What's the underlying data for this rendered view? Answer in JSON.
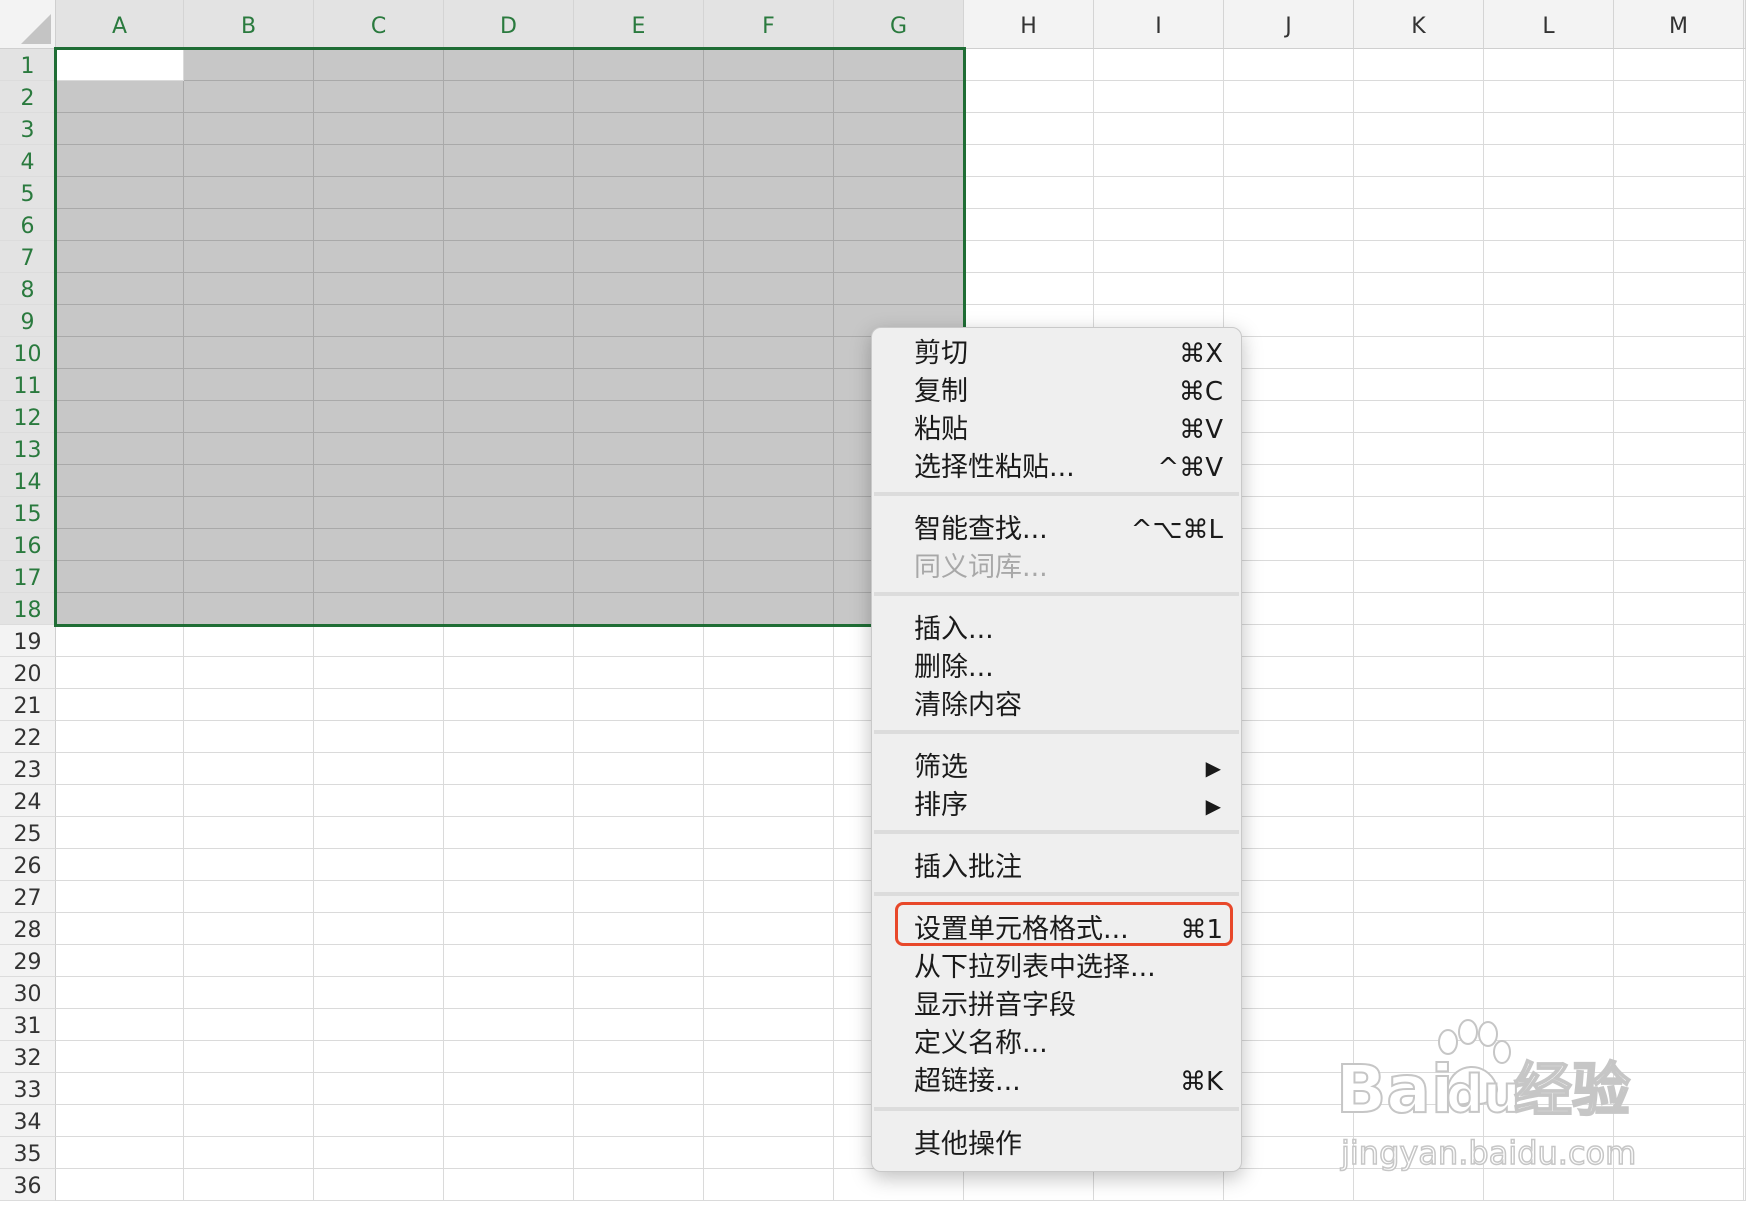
{
  "sheet": {
    "columns": [
      "A",
      "B",
      "C",
      "D",
      "E",
      "F",
      "G",
      "H",
      "I",
      "J",
      "K",
      "L",
      "M"
    ],
    "rows": [
      "1",
      "2",
      "3",
      "4",
      "5",
      "6",
      "7",
      "8",
      "9",
      "10",
      "11",
      "12",
      "13",
      "14",
      "15",
      "16",
      "17",
      "18",
      "19",
      "20",
      "21",
      "22",
      "23",
      "24",
      "25",
      "26",
      "27",
      "28",
      "29",
      "30",
      "31",
      "32",
      "33",
      "34",
      "35",
      "36"
    ],
    "selection": "A1:G18",
    "active_cell": "A1"
  },
  "context_menu": {
    "items": [
      {
        "label": "剪切",
        "shortcut": "⌘X"
      },
      {
        "label": "复制",
        "shortcut": "⌘C"
      },
      {
        "label": "粘贴",
        "shortcut": "⌘V"
      },
      {
        "label": "选择性粘贴...",
        "shortcut": "^⌘V"
      },
      {
        "label": "智能查找...",
        "shortcut": "^⌥⌘L"
      },
      {
        "label": "同义词库...",
        "shortcut": "",
        "disabled": true
      },
      {
        "label": "插入...",
        "shortcut": ""
      },
      {
        "label": "删除...",
        "shortcut": ""
      },
      {
        "label": "清除内容",
        "shortcut": ""
      },
      {
        "label": "筛选",
        "shortcut": "",
        "submenu": true
      },
      {
        "label": "排序",
        "shortcut": "",
        "submenu": true
      },
      {
        "label": "插入批注",
        "shortcut": ""
      },
      {
        "label": "设置单元格格式...",
        "shortcut": "⌘1",
        "highlighted": true
      },
      {
        "label": "从下拉列表中选择...",
        "shortcut": ""
      },
      {
        "label": "显示拼音字段",
        "shortcut": ""
      },
      {
        "label": "定义名称...",
        "shortcut": ""
      },
      {
        "label": "超链接...",
        "shortcut": "⌘K"
      },
      {
        "label": "其他操作",
        "shortcut": ""
      }
    ],
    "submenu_arrow": "▶"
  },
  "watermark": {
    "brand": "Bai du 经验",
    "brand_parts": [
      "Bai",
      "du",
      "经验"
    ],
    "url": "jingyan.baidu.com"
  },
  "colors": {
    "selection_border": "#1f6d35",
    "selected_fill": "#c7c7c7",
    "highlight": "#e8482a",
    "menu_bg": "#efefef"
  }
}
